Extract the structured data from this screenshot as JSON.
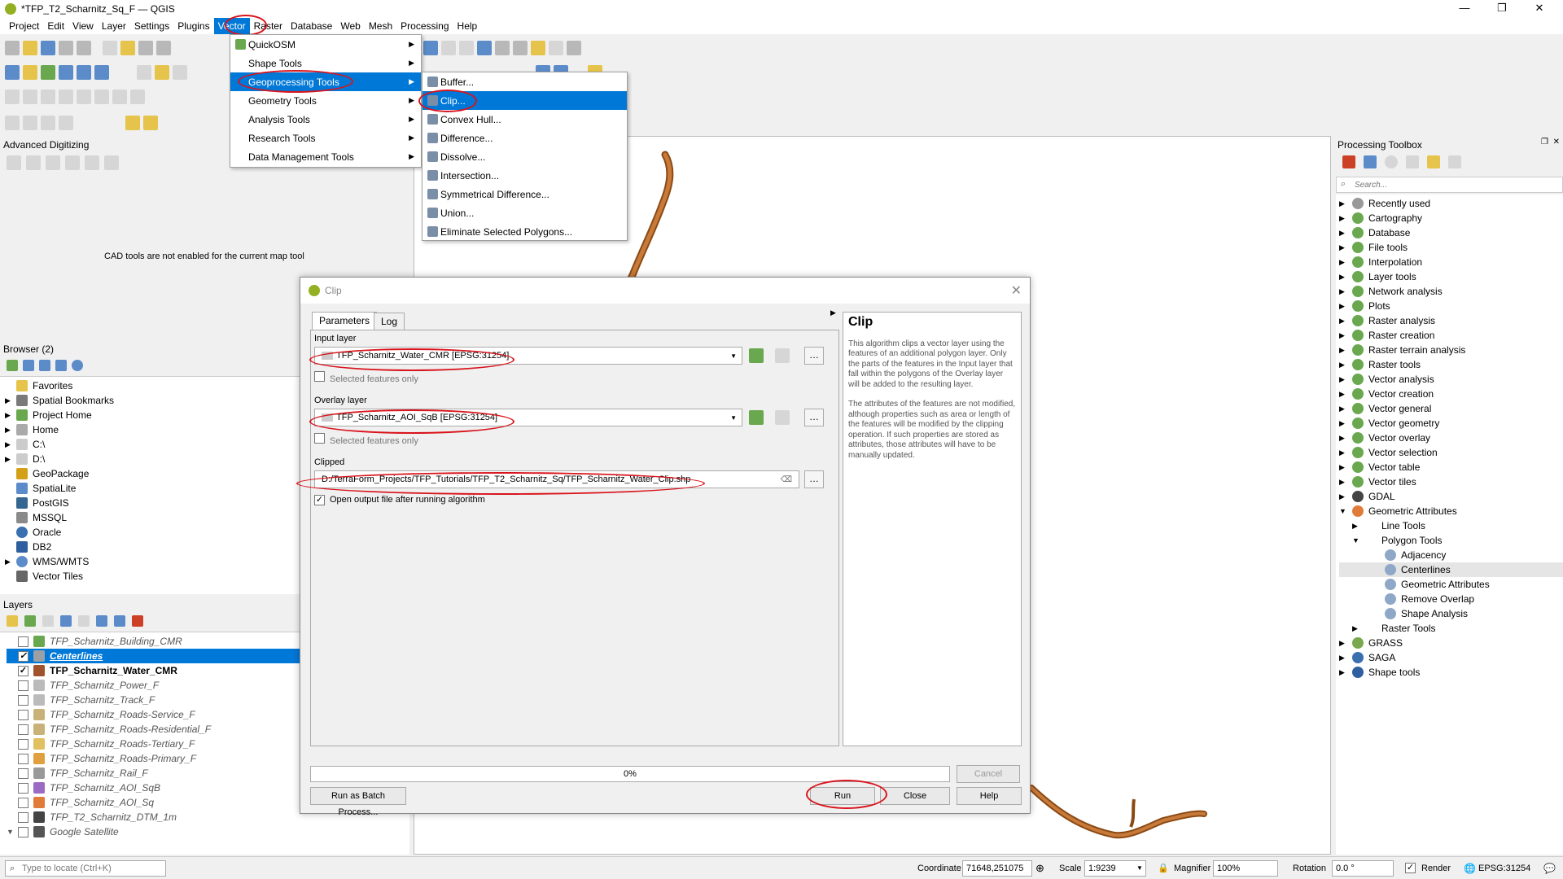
{
  "window": {
    "title": "*TFP_T2_Scharnitz_Sq_F — QGIS"
  },
  "menubar": [
    "Project",
    "Edit",
    "View",
    "Layer",
    "Settings",
    "Plugins",
    "Vector",
    "Raster",
    "Database",
    "Web",
    "Mesh",
    "Processing",
    "Help"
  ],
  "vector_menu": [
    {
      "label": "QuickOSM",
      "has_sub": true
    },
    {
      "label": "Shape Tools",
      "has_sub": true
    },
    {
      "label": "Geoprocessing Tools",
      "has_sub": true
    },
    {
      "label": "Geometry Tools",
      "has_sub": true
    },
    {
      "label": "Analysis Tools",
      "has_sub": true
    },
    {
      "label": "Research Tools",
      "has_sub": true
    },
    {
      "label": "Data Management Tools",
      "has_sub": true
    }
  ],
  "geoprocessing_menu": [
    "Buffer...",
    "Clip...",
    "Convex Hull...",
    "Difference...",
    "Dissolve...",
    "Intersection...",
    "Symmetrical Difference...",
    "Union...",
    "Eliminate Selected Polygons..."
  ],
  "advanced_digitizing": {
    "title": "Advanced Digitizing",
    "message": "CAD tools are not enabled for the current map tool"
  },
  "browser": {
    "title": "Browser (2)",
    "items": [
      "Favorites",
      "Spatial Bookmarks",
      "Project Home",
      "Home",
      "C:\\",
      "D:\\",
      "GeoPackage",
      "SpatiaLite",
      "PostGIS",
      "MSSQL",
      "Oracle",
      "DB2",
      "WMS/WMTS",
      "Vector Tiles"
    ]
  },
  "layers": {
    "title": "Layers",
    "items": [
      {
        "name": "TFP_Scharnitz_Building_CMR",
        "checked": false,
        "color": "#6aa84f"
      },
      {
        "name": "Centerlines",
        "checked": true,
        "color": "#9aa0a6"
      },
      {
        "name": "TFP_Scharnitz_Water_CMR",
        "checked": true,
        "color": "#a0522d"
      },
      {
        "name": "TFP_Scharnitz_Power_F",
        "checked": false,
        "color": "#bbbbbb"
      },
      {
        "name": "TFP_Scharnitz_Track_F",
        "checked": false,
        "color": "#bbbbbb"
      },
      {
        "name": "TFP_Scharnitz_Roads-Service_F",
        "checked": false,
        "color": "#c9b27a"
      },
      {
        "name": "TFP_Scharnitz_Roads-Residential_F",
        "checked": false,
        "color": "#c9b27a"
      },
      {
        "name": "TFP_Scharnitz_Roads-Tertiary_F",
        "checked": false,
        "color": "#e0c060"
      },
      {
        "name": "TFP_Scharnitz_Roads-Primary_F",
        "checked": false,
        "color": "#e0a040"
      },
      {
        "name": "TFP_Scharnitz_Rail_F",
        "checked": false,
        "color": "#999999"
      },
      {
        "name": "TFP_Scharnitz_AOI_SqB",
        "checked": false,
        "color": "#9b6bc4"
      },
      {
        "name": "TFP_Scharnitz_AOI_Sq",
        "checked": false,
        "color": "#e07b39"
      },
      {
        "name": "TFP_T2_Scharnitz_DTM_1m",
        "checked": false,
        "color": "#444444"
      },
      {
        "name": "Google Satellite",
        "checked": false,
        "color": "#555555"
      }
    ]
  },
  "clip_dialog": {
    "title": "Clip",
    "tabs": [
      "Parameters",
      "Log"
    ],
    "input_layer_label": "Input layer",
    "input_layer_value": "TFP_Scharnitz_Water_CMR [EPSG:31254]",
    "selected_only_label": "Selected features only",
    "overlay_layer_label": "Overlay layer",
    "overlay_layer_value": "TFP_Scharnitz_AOI_SqB [EPSG:31254]",
    "clipped_label": "Clipped",
    "clipped_value": "D:/TerraForm_Projects/TFP_Tutorials/TFP_T2_Scharnitz_Sq/TFP_Scharnitz_Water_Clip.shp",
    "open_output_label": "Open output file after running algorithm",
    "help_title": "Clip",
    "help_p1": "This algorithm clips a vector layer using the features of an additional polygon layer. Only the parts of the features in the Input layer that fall within the polygons of the Overlay layer will be added to the resulting layer.",
    "help_p2": "The attributes of the features are not modified, although properties such as area or length of the features will be modified by the clipping operation. If such properties are stored as attributes, those attributes will have to be manually updated.",
    "progress": "0%",
    "progress_fraction": 0,
    "buttons": {
      "cancel": "Cancel",
      "batch": "Run as Batch Process...",
      "run": "Run",
      "close": "Close",
      "help": "Help"
    }
  },
  "toolbox": {
    "title": "Processing Toolbox",
    "search_placeholder": "Search...",
    "groups": [
      "Recently used",
      "Cartography",
      "Database",
      "File tools",
      "Interpolation",
      "Layer tools",
      "Network analysis",
      "Plots",
      "Raster analysis",
      "Raster creation",
      "Raster terrain analysis",
      "Raster tools",
      "Vector analysis",
      "Vector creation",
      "Vector general",
      "Vector geometry",
      "Vector overlay",
      "Vector selection",
      "Vector table",
      "Vector tiles",
      "GDAL"
    ],
    "geometric_attributes": "Geometric Attributes",
    "line_tools": "Line Tools",
    "polygon_tools": "Polygon Tools",
    "polygon_items": [
      "Adjacency",
      "Centerlines",
      "Geometric Attributes",
      "Remove Overlap",
      "Shape Analysis"
    ],
    "raster_tools": "Raster Tools",
    "tail": [
      "GRASS",
      "SAGA",
      "Shape tools"
    ]
  },
  "statusbar": {
    "locate_placeholder": "Type to locate (Ctrl+K)",
    "coordinate_label": "Coordinate",
    "coordinate_value": "71648,251075",
    "scale_label": "Scale",
    "scale_value": "1:9239",
    "magnifier_label": "Magnifier",
    "magnifier_value": "100%",
    "rotation_label": "Rotation",
    "rotation_value": "0.0 °",
    "render_label": "Render",
    "crs": "EPSG:31254"
  }
}
